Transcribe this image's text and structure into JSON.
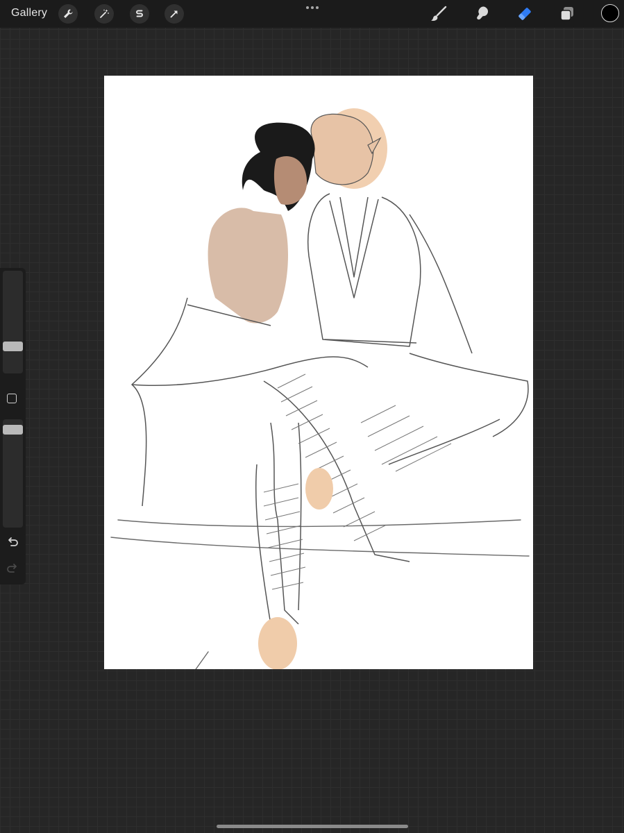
{
  "topbar": {
    "gallery_label": "Gallery",
    "left_tools": [
      "wrench-icon",
      "magic-wand-icon",
      "selection-s-icon",
      "transform-arrow-icon"
    ],
    "right_tools": [
      "brush-icon",
      "smudge-icon",
      "eraser-icon",
      "layers-icon"
    ],
    "active_tool": "eraser-icon",
    "active_color": "#000000",
    "accent_color": "#2f7cf6"
  },
  "sidebar": {
    "controls": [
      "brush-size-slider",
      "modify-button",
      "opacity-slider",
      "undo-icon",
      "redo-icon"
    ],
    "redo_enabled": false
  },
  "canvas": {
    "background": "#ffffff",
    "content": "artwork"
  }
}
